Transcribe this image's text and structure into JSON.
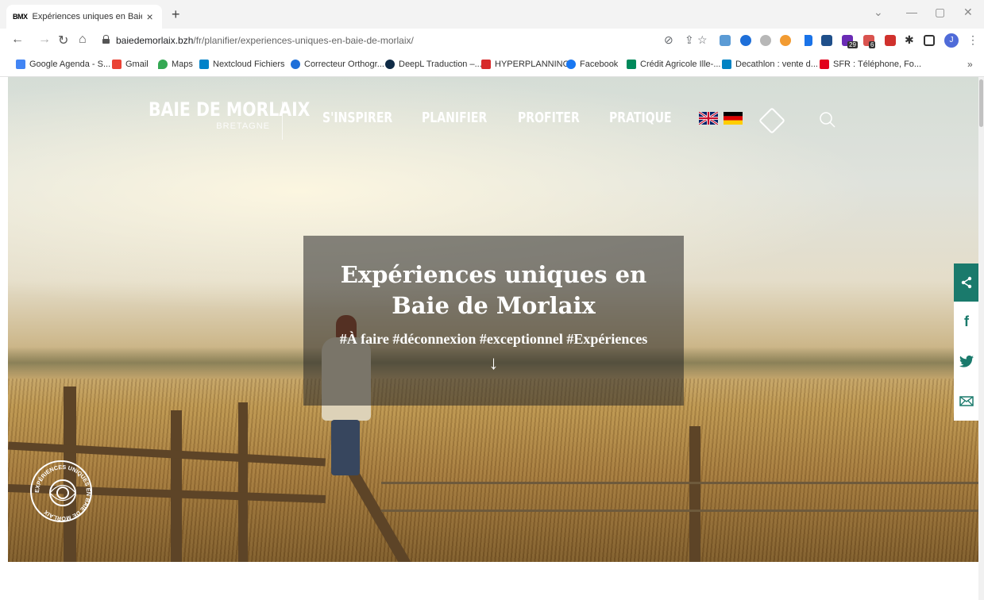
{
  "browser": {
    "tab": {
      "favicon_text": "BMX",
      "title": "Expériences uniques en Baie de M",
      "close": "×",
      "new_tab": "+"
    },
    "window_controls": [
      "⌄",
      "—",
      "▢",
      "✕"
    ],
    "url": {
      "host": "baiedemorlaix.bzh",
      "path": "/fr/planifier/experiences-uniques-en-baie-de-morlaix/"
    },
    "profile_initial": "J",
    "extension_badges": [
      "29",
      "6"
    ],
    "bookmarks": [
      {
        "label": "Google Agenda - S...",
        "icon": "calendar-icon",
        "color": "#4285f4"
      },
      {
        "label": "Gmail",
        "icon": "gmail-icon",
        "color": "#ea4335"
      },
      {
        "label": "Maps",
        "icon": "maps-icon",
        "color": "#34a853"
      },
      {
        "label": "Nextcloud Fichiers",
        "icon": "nextcloud-icon",
        "color": "#0082c9"
      },
      {
        "label": "Correcteur Orthogr...",
        "icon": "corrector-icon",
        "color": "#1e6fd9"
      },
      {
        "label": "DeepL Traduction –...",
        "icon": "deepl-icon",
        "color": "#0f2b46"
      },
      {
        "label": "HYPERPLANNING",
        "icon": "hyperplanning-icon",
        "color": "#d72b2b"
      },
      {
        "label": "Facebook",
        "icon": "facebook-icon",
        "color": "#1877f2"
      },
      {
        "label": "Crédit Agricole Ille-...",
        "icon": "credit-agricole-icon",
        "color": "#00895a"
      },
      {
        "label": "Decathlon : vente d...",
        "icon": "decathlon-icon",
        "color": "#0082c3"
      },
      {
        "label": "SFR : Téléphone, Fo...",
        "icon": "sfr-icon",
        "color": "#e2001a"
      }
    ],
    "bookmarks_more": "»"
  },
  "site": {
    "logo": {
      "main": "BAIE DE MORLAIX",
      "sub": "BRETAGNE"
    },
    "menu": [
      "S'INSPIRER",
      "PLANIFIER",
      "PROFITER",
      "PRATIQUE"
    ],
    "hero": {
      "title": "Expériences uniques en Baie de Morlaix",
      "tags": "#À faire #déconnexion #exceptionnel #Expériences",
      "scroll_arrow": "↓"
    },
    "badge_text": "EXPÉRIENCES UNIQUES EN BAIE DE MORLAIX",
    "share_color": "#1a7a6c"
  }
}
